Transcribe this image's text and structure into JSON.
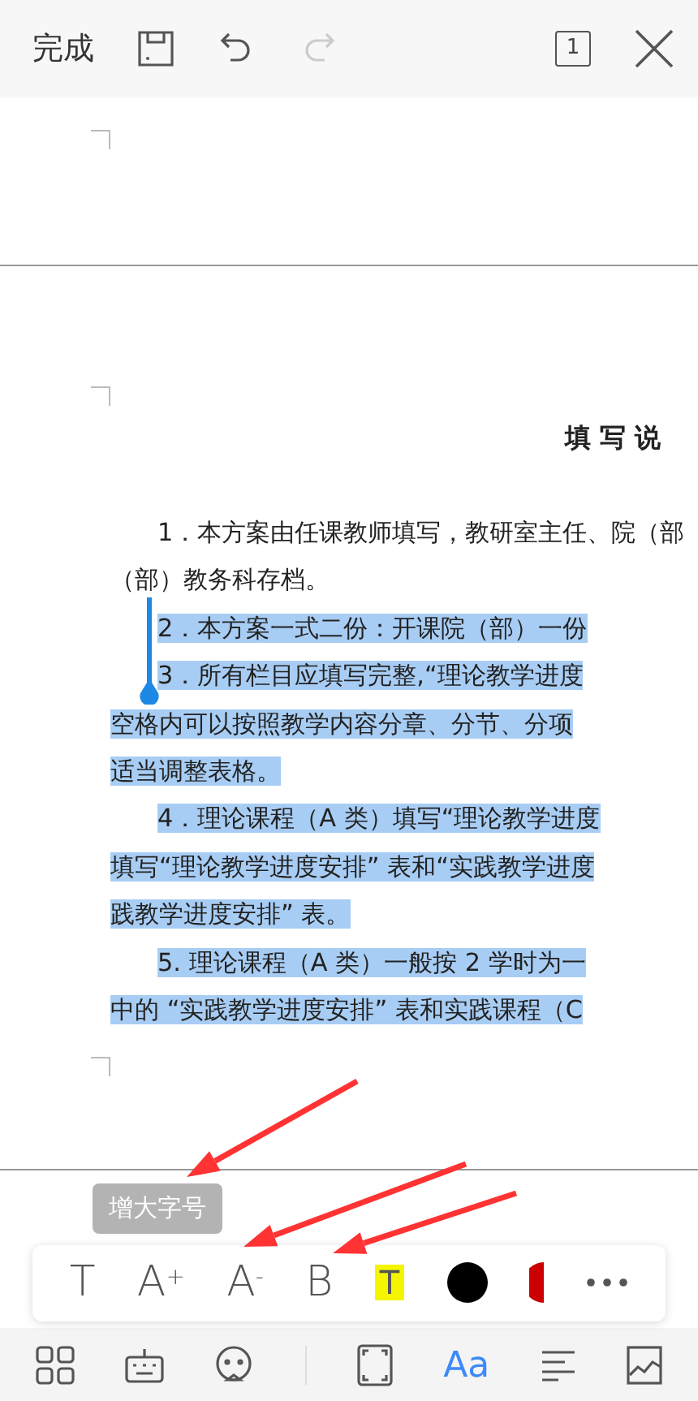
{
  "top_bar": {
    "done_label": "完成",
    "redo_disabled": true,
    "page_number": "1"
  },
  "document": {
    "title": "填 写 说",
    "lines": [
      {
        "text": "1．本方案由任课教师填写，教研室主任、院（部",
        "indent": true,
        "selected": false
      },
      {
        "text": "（部）教务科存档。",
        "indent": false,
        "selected": false
      },
      {
        "text": "2．本方案一式二份：开课院（部）一份",
        "indent": true,
        "selected": true
      },
      {
        "text": "3．所有栏目应填写完整,“理论教学进度",
        "indent": true,
        "selected": true
      },
      {
        "text": "空格内可以按照教学内容分章、分节、分项",
        "indent": false,
        "selected": true
      },
      {
        "text": "适当调整表格。",
        "indent": false,
        "selected": true
      },
      {
        "text": "4．理论课程（A 类）填写“理论教学进度",
        "indent": true,
        "selected": true
      },
      {
        "text": "填写“理论教学进度安排” 表和“实践教学进度",
        "indent": false,
        "selected": true
      },
      {
        "text": "践教学进度安排” 表。",
        "indent": false,
        "selected": true
      },
      {
        "text": "5. 理论课程（A 类）一般按 2 学时为一",
        "indent": true,
        "selected": true
      },
      {
        "text": "中的 “实践教学进度安排” 表和实践课程（C",
        "indent": false,
        "selected": true
      }
    ]
  },
  "tooltip": "增大字号",
  "format_toolbar": [
    {
      "kind": "text",
      "label": "T"
    },
    {
      "kind": "text",
      "label": "A$^{+}$"
    },
    {
      "kind": "text",
      "label": "A$^{-}$"
    },
    {
      "kind": "text",
      "label": "B"
    },
    {
      "kind": "highlight",
      "label": "T"
    },
    {
      "kind": "swatch",
      "color": "#000000"
    },
    {
      "kind": "half-swatch",
      "color": "#cc0000"
    },
    {
      "kind": "more"
    }
  ],
  "bottom_bar": [
    {
      "kind": "grid",
      "selected": false
    },
    {
      "kind": "keyboard",
      "selected": false
    },
    {
      "kind": "face",
      "selected": false
    },
    {
      "kind": "divider"
    },
    {
      "kind": "frame",
      "selected": false
    },
    {
      "kind": "text",
      "label": "Aa",
      "selected": true
    },
    {
      "kind": "align",
      "selected": false
    },
    {
      "kind": "chart",
      "selected": false
    }
  ]
}
